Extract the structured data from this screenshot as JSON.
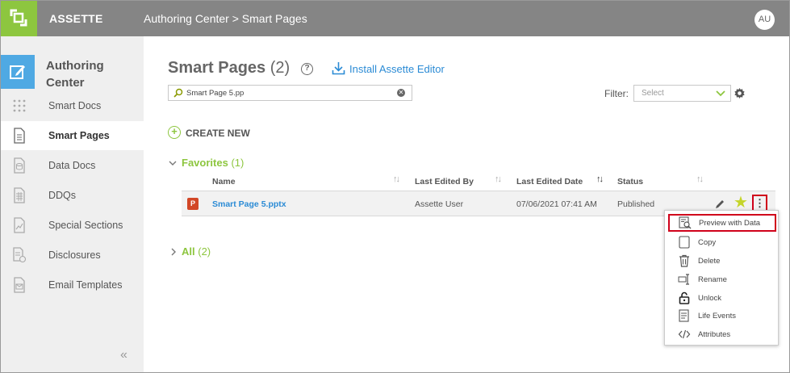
{
  "app": {
    "brand": "ASSETTE",
    "breadcrumb": "Authoring Center > Smart Pages",
    "user_initials": "AU"
  },
  "sidebar": {
    "header": "Authoring Center",
    "items": [
      {
        "label": "Smart Docs",
        "icon": "grid-icon"
      },
      {
        "label": "Smart Pages",
        "icon": "page-icon"
      },
      {
        "label": "Data Docs",
        "icon": "data-doc-icon"
      },
      {
        "label": "DDQs",
        "icon": "ddq-icon"
      },
      {
        "label": "Special Sections",
        "icon": "special-section-icon"
      },
      {
        "label": "Disclosures",
        "icon": "disclosure-icon"
      },
      {
        "label": "Email Templates",
        "icon": "email-template-icon"
      }
    ],
    "active_index": 1,
    "collapse": "«"
  },
  "main": {
    "title": "Smart Pages",
    "title_count": "(2)",
    "help": "?",
    "install_label": "Install Assette Editor",
    "search_value": "Smart Page 5.pp",
    "filter_label": "Filter:",
    "filter_placeholder": "Select",
    "create_label": "CREATE NEW",
    "favorites": {
      "title": "Favorites",
      "count": "(1)"
    },
    "all": {
      "title": "All",
      "count": "(2)"
    },
    "columns": [
      "Name",
      "Last Edited By",
      "Last Edited Date",
      "Status"
    ],
    "rows": [
      {
        "name": "Smart Page 5.pptx",
        "edited_by": "Assette User",
        "edited_date": "07/06/2021 07:41 AM",
        "status": "Published"
      }
    ]
  },
  "context_menu": {
    "items": [
      {
        "label": "Preview with Data",
        "icon": "preview-icon"
      },
      {
        "label": "Copy",
        "icon": "copy-icon"
      },
      {
        "label": "Delete",
        "icon": "trash-icon"
      },
      {
        "label": "Rename",
        "icon": "rename-icon"
      },
      {
        "label": "Unlock",
        "icon": "unlock-icon"
      },
      {
        "label": "Life Events",
        "icon": "life-events-icon"
      },
      {
        "label": "Attributes",
        "icon": "code-icon"
      }
    ]
  },
  "colors": {
    "accent_green": "#8dc63f",
    "topbar": "#858585",
    "link_blue": "#2b8bd5",
    "highlight_red": "#d0021b"
  }
}
